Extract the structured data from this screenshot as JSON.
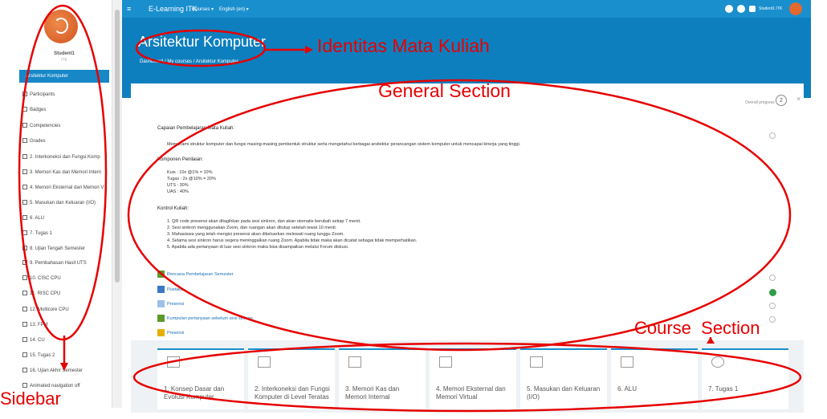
{
  "sidebar": {
    "user_name": "Student1",
    "user_sub": "ITK",
    "active_item": "Arsitektur Komputer",
    "items": [
      "Participants",
      "Badges",
      "Competencies",
      "Grades",
      "2. Interkoneksi dan Fungsi Komp",
      "3. Memori Kas dan Memori Intern",
      "4. Memori Eksternal dan Memori V",
      "5. Masukan dan Keluaran (I/O)",
      "6. ALU",
      "7. Tugas 1",
      "8. Ujian Tengah Semester",
      "9. Pembahasan Hasil UTS",
      "10. CISC CPU",
      "11. RISC CPU",
      "12. Multicore CPU",
      "13. FPM",
      "14. CU",
      "15. Tugas 2",
      "16. Ujian Akhir Semester",
      "Animated navigation off"
    ]
  },
  "topbar": {
    "menu_glyph": "≡",
    "brand": "E-Learning ITK",
    "courses": "Courses ▾",
    "language": "English (en) ▾",
    "user": "Student1 ITK"
  },
  "header": {
    "title": "Arsitektur Komputer",
    "breadcrumb": "Dashboard / My courses / Arsitektur Komputer"
  },
  "general": {
    "progress_label": "Overall progress",
    "progress_value": "2",
    "capaian_head": "Capaian Pembelajaran Mata Kuliah:",
    "capaian_text": "Memahami struktur komputer dan fungsi masing-masing pembentuk struktur serta mengetahui berbagai arsitektur perancangan sistem komputer untuk mencapai kinerja yang tinggi.",
    "komponen_head": "Komponen Penilaian:",
    "komponen": [
      "Kuis : 10x @1% = 10%",
      "Tugas : 2x @10% = 20%",
      "UTS : 30%",
      "UAS : 40%"
    ],
    "kontrol_head": "Kontrol Kuliah:",
    "kontrol": [
      "1. QR code presensi akan ditagihkan pada sesi sinkron, dan akan otomatis berubah setiap 7 menit.",
      "2. Sesi sinkron menggunakan Zoom, dan ruangan akan ditutup setelah lewat 10 menit.",
      "3. Mahasiswa yang telah mengisi presensi akan dikeluarkan melewati ruang tunggu Zoom.",
      "4. Selama sesi sinkron harus segera meninggalkan ruang Zoom. Apabila tidak maka akan dicatat sebagai tidak memperhatikan.",
      "5. Apabila ada pertanyaan di luar sesi sinkron maka bisa disampaikan melalui Forum diskusi."
    ],
    "activities": [
      "Rencana Pembelajaran Semester",
      "Pustaka",
      "Presensi",
      "Kumpulan pertanyaan sebelum sesi sinkron",
      "Presensi"
    ]
  },
  "course_tiles": [
    "1. Konsep Dasar dan Evolusi Komputer",
    "2. Interkoneksi dan Fungsi Komputer di Level Teratas",
    "3. Memori Kas dan Memori Internal",
    "4. Memori Eksternal dan Memori Virtual",
    "5. Masukan dan Keluaran (I/O)",
    "6. ALU",
    "7. Tugas 1"
  ],
  "annotations": {
    "identitas": "Identitas Mata Kuliah",
    "general": "General Section",
    "course": "Course  Section",
    "sidebar": "Sidebar"
  },
  "colors": {
    "annotation": "#e60000",
    "brand": "#1a8fce",
    "band": "#0e7fbe"
  }
}
